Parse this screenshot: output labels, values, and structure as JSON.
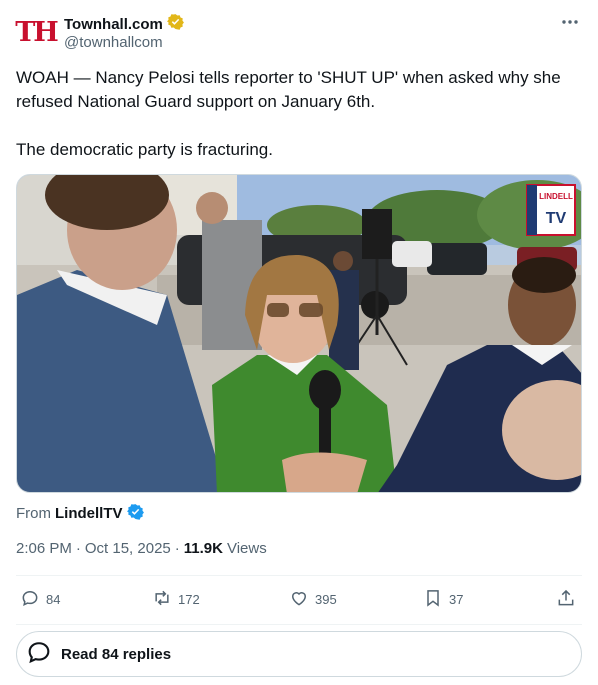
{
  "author": {
    "avatar_text": "TH",
    "display_name": "Townhall.com",
    "handle": "@townhallcom",
    "verified_badge": "gold-verified-icon"
  },
  "tweet": {
    "text": "WOAH — Nancy Pelosi tells reporter to 'SHUT UP' when asked why she refused National Guard support on January 6th.\n\nThe democratic party is fracturing."
  },
  "media": {
    "watermark_top": "LINDELL",
    "watermark_bottom": "TV"
  },
  "source": {
    "prefix": "From",
    "name": "LindellTV"
  },
  "meta": {
    "time": "2:06 PM",
    "separator": "·",
    "date": "Oct 15, 2025",
    "views_count": "11.9K",
    "views_label": "Views"
  },
  "actions": {
    "replies": "84",
    "reposts": "172",
    "likes": "395",
    "bookmarks": "37"
  },
  "read_replies": {
    "label": "Read 84 replies"
  },
  "colors": {
    "text": "#0f1419",
    "muted": "#536471",
    "brand_red": "#c8102e",
    "verified_blue": "#1d9bf0",
    "verified_gold": "#e2b719",
    "border": "#cfd9de"
  }
}
